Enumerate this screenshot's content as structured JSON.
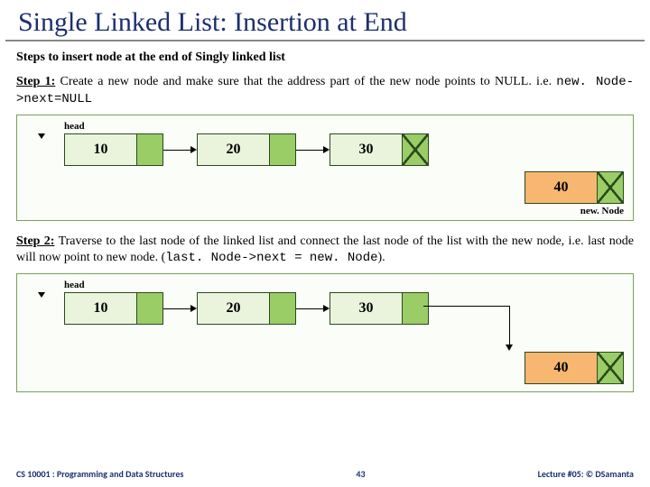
{
  "title": "Single Linked List: Insertion at End",
  "subhead": "Steps to insert node at the end of Singly linked list",
  "step1": {
    "label": "Step 1:",
    "text": " Create a new node and make sure that the address part of the new node points to NULL. i.e. ",
    "code": "new. Node->next=NULL"
  },
  "step2": {
    "label": "Step 2:",
    "text": " Traverse to the last node of the linked list and connect the last node of the list with the new node, i.e. last node will now point to new node. (",
    "code": "last. Node->next = new. Node",
    "close": ")."
  },
  "labels": {
    "head": "head",
    "newNode": "new. Node"
  },
  "nodes": {
    "n1": "10",
    "n2": "20",
    "n3": "30",
    "new": "40"
  },
  "footer": {
    "left": "CS 10001 : Programming and Data Structures",
    "mid": "43",
    "right": "Lecture #05: © DSamanta"
  }
}
